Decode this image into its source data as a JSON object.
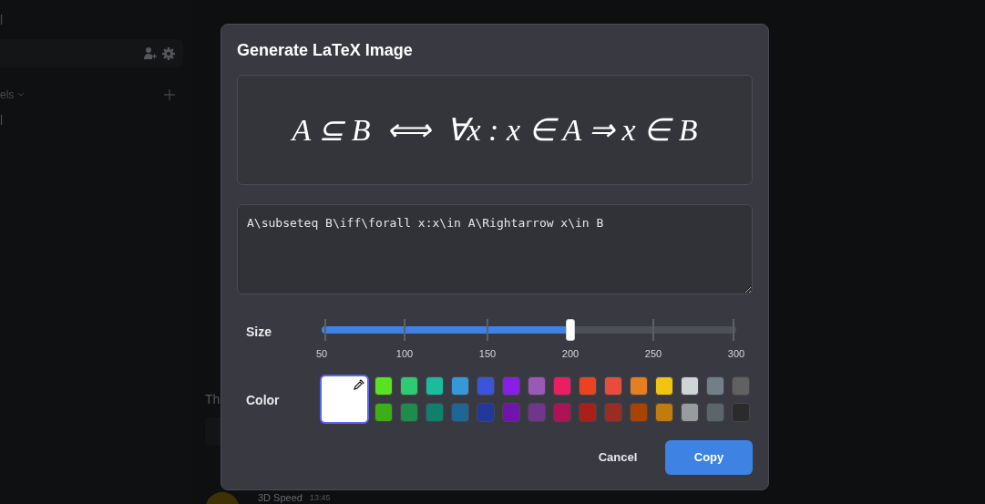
{
  "background": {
    "sidebar": {
      "top_text": "l",
      "section_label": "els",
      "channel": "l"
    },
    "chat": {
      "text": "Th",
      "author": "3D Speed",
      "time": "13:45"
    }
  },
  "dialog": {
    "title": "Generate LaTeX Image",
    "preview": "A ⊆ B  ⟺  ∀x : x ∈ A ⇒ x ∈ B",
    "source": "A\\subseteq B\\iff\\forall x:x\\in A\\Rightarrow x\\in B",
    "size": {
      "label": "Size",
      "level": 0.6,
      "ticks": [
        "50",
        "100",
        "150",
        "200",
        "250",
        "300"
      ]
    },
    "color": {
      "label": "Color",
      "custom": {
        "color": "#ffffff",
        "selected": true
      },
      "swatches": [
        {
          "color": "#57e31f",
          "selected": false
        },
        {
          "color": "#2ecc71",
          "selected": false
        },
        {
          "color": "#1abc9c",
          "selected": false
        },
        {
          "color": "#3498db",
          "selected": false
        },
        {
          "color": "#3a55d9",
          "selected": false
        },
        {
          "color": "#8a1ee6",
          "selected": false
        },
        {
          "color": "#9b59b6",
          "selected": false
        },
        {
          "color": "#e91e63",
          "selected": false
        },
        {
          "color": "#e8441f",
          "selected": false
        },
        {
          "color": "#e74c3c",
          "selected": false
        },
        {
          "color": "#e67e22",
          "selected": false
        },
        {
          "color": "#f1c40f",
          "selected": false
        },
        {
          "color": "#cfd4d5",
          "selected": false
        },
        {
          "color": "#707f88",
          "selected": false
        },
        {
          "color": "#616161",
          "selected": false
        },
        {
          "color": "#3caf17",
          "selected": false
        },
        {
          "color": "#1f8b4c",
          "selected": false
        },
        {
          "color": "#11806a",
          "selected": false
        },
        {
          "color": "#206694",
          "selected": false
        },
        {
          "color": "#20399a",
          "selected": false
        },
        {
          "color": "#7014ad",
          "selected": false
        },
        {
          "color": "#71368a",
          "selected": false
        },
        {
          "color": "#ad1457",
          "selected": false
        },
        {
          "color": "#a8201a",
          "selected": false
        },
        {
          "color": "#992d22",
          "selected": false
        },
        {
          "color": "#a84300",
          "selected": false
        },
        {
          "color": "#c27c0e",
          "selected": false
        },
        {
          "color": "#979c9f",
          "selected": false
        },
        {
          "color": "#5b666b",
          "selected": false
        },
        {
          "color": "#2b2b2b",
          "selected": false
        }
      ]
    },
    "buttons": [
      {
        "label": "Cancel",
        "kind": "secondary"
      },
      {
        "label": "Copy",
        "kind": "primary"
      }
    ]
  }
}
